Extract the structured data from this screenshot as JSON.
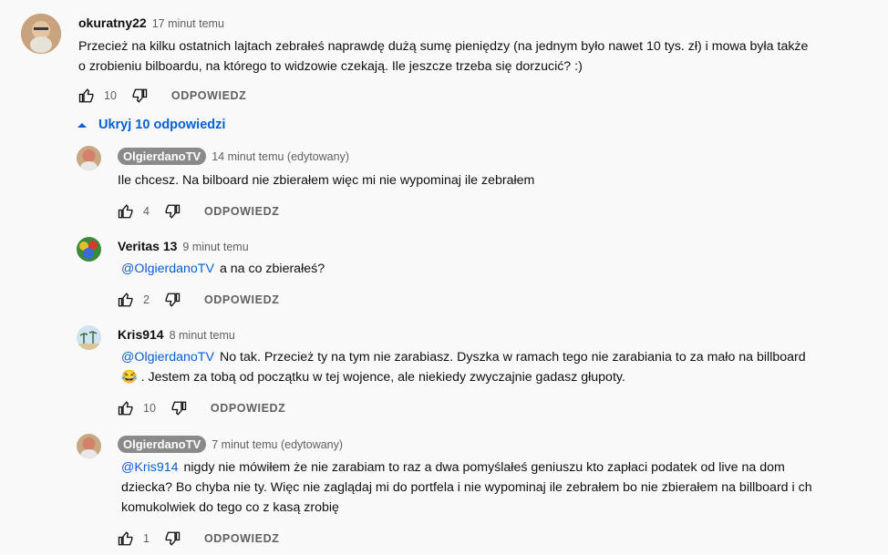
{
  "comments": {
    "main": {
      "author": "okuratny22",
      "time": "17 minut temu",
      "line1": "Przecież na kilku ostatnich lajtach zebrałeś naprawdę dużą sumę pieniędzy (na jednym było nawet 10 tys. zł) i mowa była także",
      "line2": "o zrobieniu bilboardu, na którego to widzowie czekają. Ile jeszcze trzeba się dorzucić? :)",
      "likes": "10",
      "reply": "ODPOWIEDZ"
    },
    "toggle_label": "Ukryj 10 odpowiedzi",
    "replies": [
      {
        "author": "OlgierdanoTV",
        "time": "14 minut temu (edytowany)",
        "text": "Ile chcesz. Na bilboard nie zbierałem więc mi nie wypominaj ile zebrałem",
        "likes": "4",
        "reply": "ODPOWIEDZ"
      },
      {
        "author": "Veritas 13",
        "time": "9 minut temu",
        "mention": "@OlgierdanoTV",
        "text": "a na co zbierałeś?",
        "likes": "2",
        "reply": "ODPOWIEDZ"
      },
      {
        "author": "Kris914",
        "time": "8 minut temu",
        "mention": "@OlgierdanoTV",
        "text": "No tak. Przecież ty na tym nie zarabiasz. Dyszka w ramach tego nie zarabiania to za mało na billboard",
        "line2": "😂 . Jestem za tobą od początku w tej wojence, ale niekiedy zwyczajnie gadasz głupoty.",
        "likes": "10",
        "reply": "ODPOWIEDZ"
      },
      {
        "author": "OlgierdanoTV",
        "time": "7 minut temu (edytowany)",
        "mention": "@Kris914",
        "text": "nigdy nie mówiłem że nie zarabiam to raz a dwa pomyślałeś geniuszu kto zapłaci podatek od live na dom",
        "line2": "dziecka? Bo chyba nie ty. Więc nie zaglądaj mi do portfela i nie wypominaj ile zebrałem bo nie zbierałem na billboard i ch",
        "line3": "komukolwiek do tego co z kasą zrobię",
        "likes": "1",
        "reply": "ODPOWIEDZ"
      }
    ]
  }
}
